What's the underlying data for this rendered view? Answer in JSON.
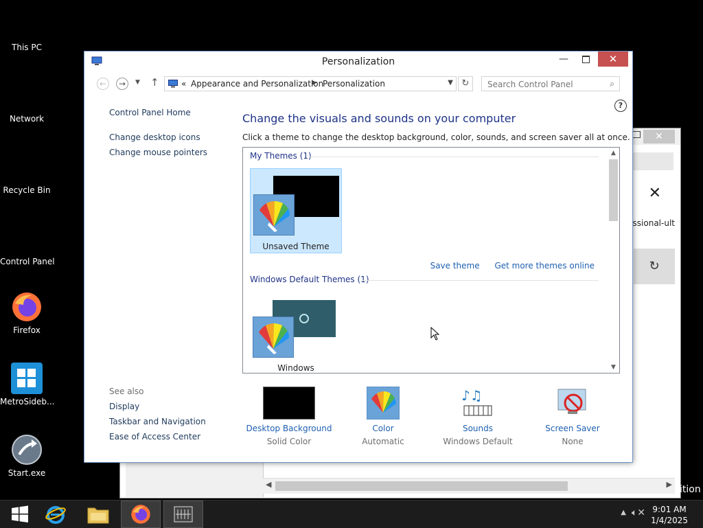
{
  "desktop": {
    "icons": [
      {
        "label": "This PC"
      },
      {
        "label": "Network"
      },
      {
        "label": "Recycle Bin"
      },
      {
        "label": "Control Panel"
      },
      {
        "label": "Firefox"
      },
      {
        "label": "MetroSideb..."
      },
      {
        "label": "Start.exe"
      }
    ]
  },
  "background_window": {
    "partial_text": "essional-ult",
    "edition_text": "ition"
  },
  "window": {
    "title": "Personalization",
    "close_symbol": "✕",
    "min_symbol": "—"
  },
  "address_bar": {
    "overflow": "«",
    "crumbs": [
      "Appearance and Personalization",
      "Personalization"
    ],
    "search_placeholder": "Search Control Panel"
  },
  "left_nav": {
    "home": "Control Panel Home",
    "links": [
      "Change desktop icons",
      "Change mouse pointers"
    ]
  },
  "content": {
    "heading": "Change the visuals and sounds on your computer",
    "description": "Click a theme to change the desktop background, color, sounds, and screen saver all at once."
  },
  "themes": {
    "my_themes_header": "My Themes (1)",
    "unsaved_theme": "Unsaved Theme",
    "save_theme": "Save theme",
    "get_more": "Get more themes online",
    "default_header": "Windows Default Themes (1)",
    "windows_theme": "Windows"
  },
  "see_also": {
    "header": "See also",
    "links": [
      "Display",
      "Taskbar and Navigation",
      "Ease of Access Center"
    ]
  },
  "bottom": {
    "desktop_background": {
      "label": "Desktop Background",
      "value": "Solid Color"
    },
    "color": {
      "label": "Color",
      "value": "Automatic"
    },
    "sounds": {
      "label": "Sounds",
      "value": "Windows Default"
    },
    "screen_saver": {
      "label": "Screen Saver",
      "value": "None"
    }
  },
  "taskbar": {
    "time": "9:01 AM",
    "date": "1/4/2025"
  },
  "colors": {
    "accent_link": "#1e60b0",
    "heading_blue": "#1e3287",
    "close_red": "#c75050",
    "selection": "#cce8ff"
  }
}
